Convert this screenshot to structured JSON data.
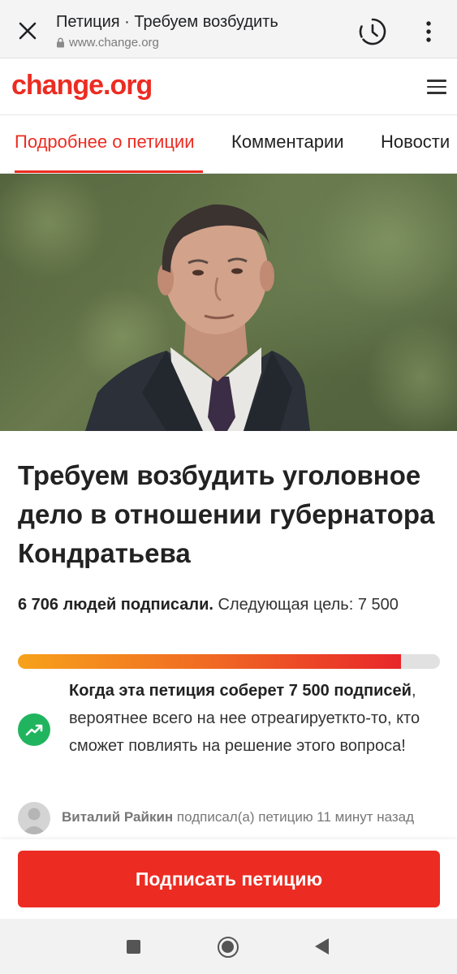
{
  "browser": {
    "title": "Петиция · Требуем возбудить",
    "url": "www.change.org"
  },
  "site": {
    "logo": "change.org",
    "brand_color": "#ec2c22"
  },
  "tabs": [
    {
      "label": "Подробнее о петиции",
      "active": true
    },
    {
      "label": "Комментарии",
      "active": false
    },
    {
      "label": "Новости",
      "active": false
    }
  ],
  "petition": {
    "title": "Требуем возбудить уголовное дело в отношении губернатора Кондратьева",
    "signed_count_text": "6 706 людей подписали.",
    "next_goal_text": "Следующая цель: 7 500",
    "progress_fraction": 0.907,
    "milestone_bold": "Когда эта петиция соберет 7 500 подписей",
    "milestone_rest": ", вероятнее всего на нее отреагируеткто-то, кто сможет повлиять на решение этого вопроса!",
    "recent_signer_name": "Виталий Райкин",
    "recent_signer_action": "подписал(а) петицию 11 минут назад",
    "sign_button": "Подписать петицию"
  },
  "icons": {
    "close": "close-icon",
    "history": "history-icon",
    "more": "more-vert-icon",
    "lock": "lock-icon",
    "menu": "hamburger-icon",
    "trending": "trending-up-icon"
  }
}
